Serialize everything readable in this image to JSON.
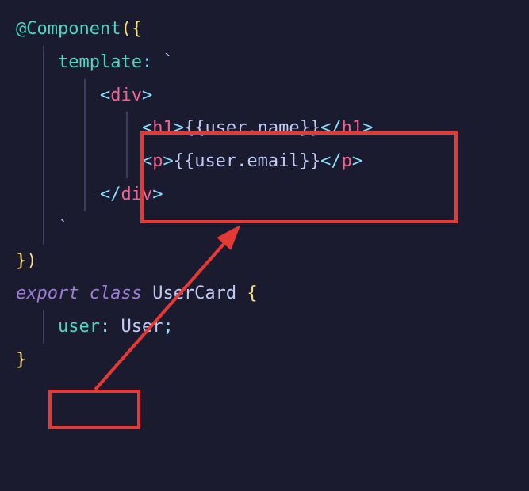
{
  "code": {
    "l1": {
      "decorator": "@Component",
      "brace": "({"
    },
    "l2": {
      "prop": "template",
      "colon": ": ",
      "tick": "`"
    },
    "l3": {
      "open": "<",
      "tag": "div",
      "close": ">"
    },
    "l4": {
      "open1": "<",
      "tag1": "h1",
      "close1": ">",
      "expr": "{{user.name}}",
      "open2": "</",
      "tag2": "h1",
      "close2": ">"
    },
    "l5": {
      "open1": "<",
      "tag1": "p",
      "close1": ">",
      "expr": "{{user.email}}",
      "open2": "</",
      "tag2": "p",
      "close2": ">"
    },
    "l6": {
      "open": "</",
      "tag": "div",
      "close": ">"
    },
    "l7": {
      "tick": "`"
    },
    "l8": {
      "text": "})"
    },
    "l9": {
      "kw1": "export ",
      "kw2": "class ",
      "name": "UserCard ",
      "brace": "{"
    },
    "l10": {
      "field": "user",
      "colon": ":",
      "sp": " ",
      "type": "User",
      "semi": ";"
    },
    "l11": {
      "brace": "}"
    }
  }
}
